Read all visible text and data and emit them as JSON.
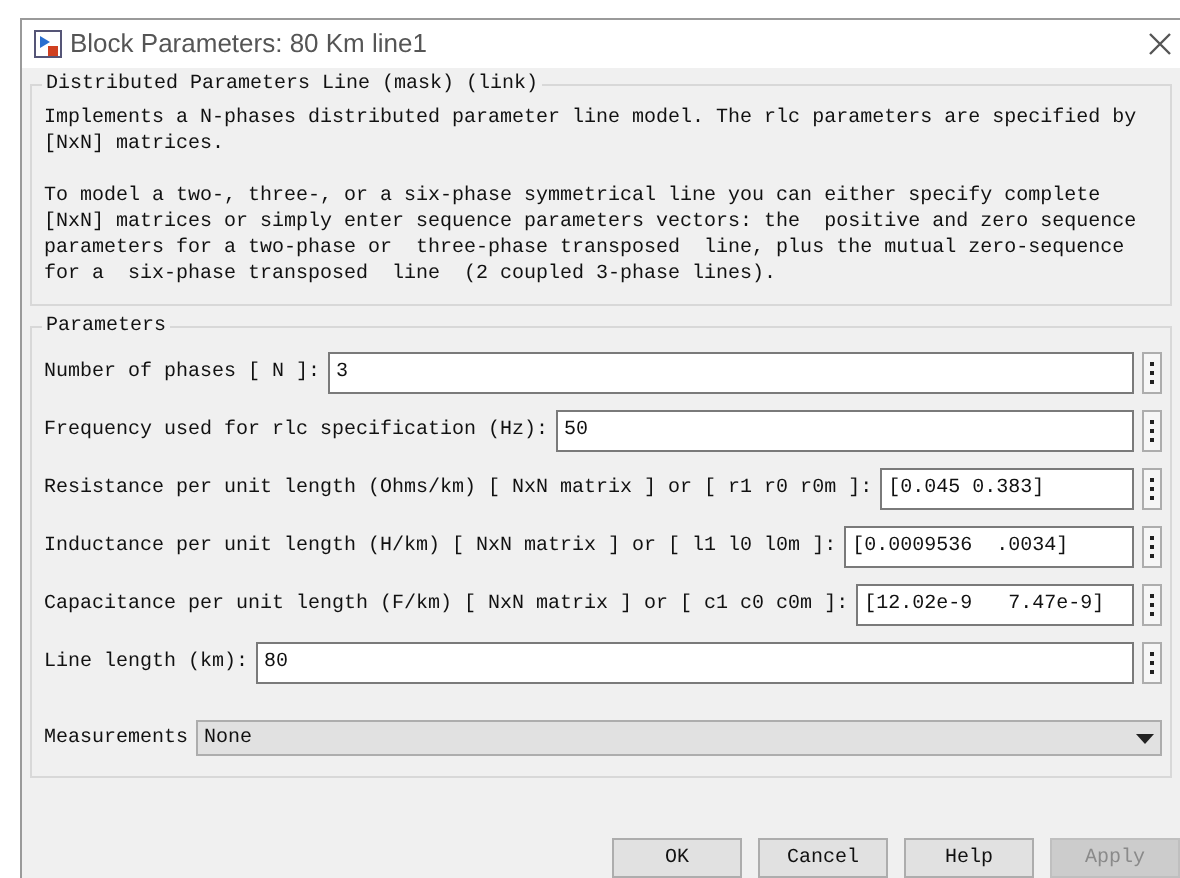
{
  "window": {
    "title": "Block Parameters: 80 Km line1"
  },
  "mask": {
    "title": "Distributed Parameters Line (mask) (link)",
    "paragraphs": [
      "Implements a N-phases distributed parameter line model. The rlc parameters are specified by [NxN] matrices.",
      "To model a two-, three-, or a six-phase symmetrical line you can either specify complete [NxN] matrices or simply enter sequence parameters vectors: the  positive and zero sequence parameters for a two-phase or  three-phase transposed  line, plus the mutual zero-sequence for a  six-phase transposed  line  (2 coupled 3-phase lines)."
    ]
  },
  "parameters": {
    "title": "Parameters",
    "fields": [
      {
        "label": "Number of phases [ N ]:",
        "value": "3"
      },
      {
        "label": "Frequency used for rlc specification (Hz):",
        "value": "50"
      },
      {
        "label": "Resistance per unit length (Ohms/km) [ NxN matrix ] or [ r1 r0 r0m ]:",
        "value": "[0.045 0.383]"
      },
      {
        "label": "Inductance per unit length (H/km) [ NxN matrix ] or [ l1 l0 l0m ]:",
        "value": "[0.0009536  .0034]"
      },
      {
        "label": "Capacitance per unit length (F/km) [ NxN matrix ] or [ c1 c0 c0m ]:",
        "value": "[12.02e-9   7.47e-9]"
      },
      {
        "label": "Line length (km):",
        "value": "80"
      }
    ],
    "measurements": {
      "label": "Measurements",
      "value": "None"
    }
  },
  "buttons": [
    {
      "label": "OK",
      "disabled": false
    },
    {
      "label": "Cancel",
      "disabled": false
    },
    {
      "label": "Help",
      "disabled": false
    },
    {
      "label": "Apply",
      "disabled": true
    }
  ]
}
